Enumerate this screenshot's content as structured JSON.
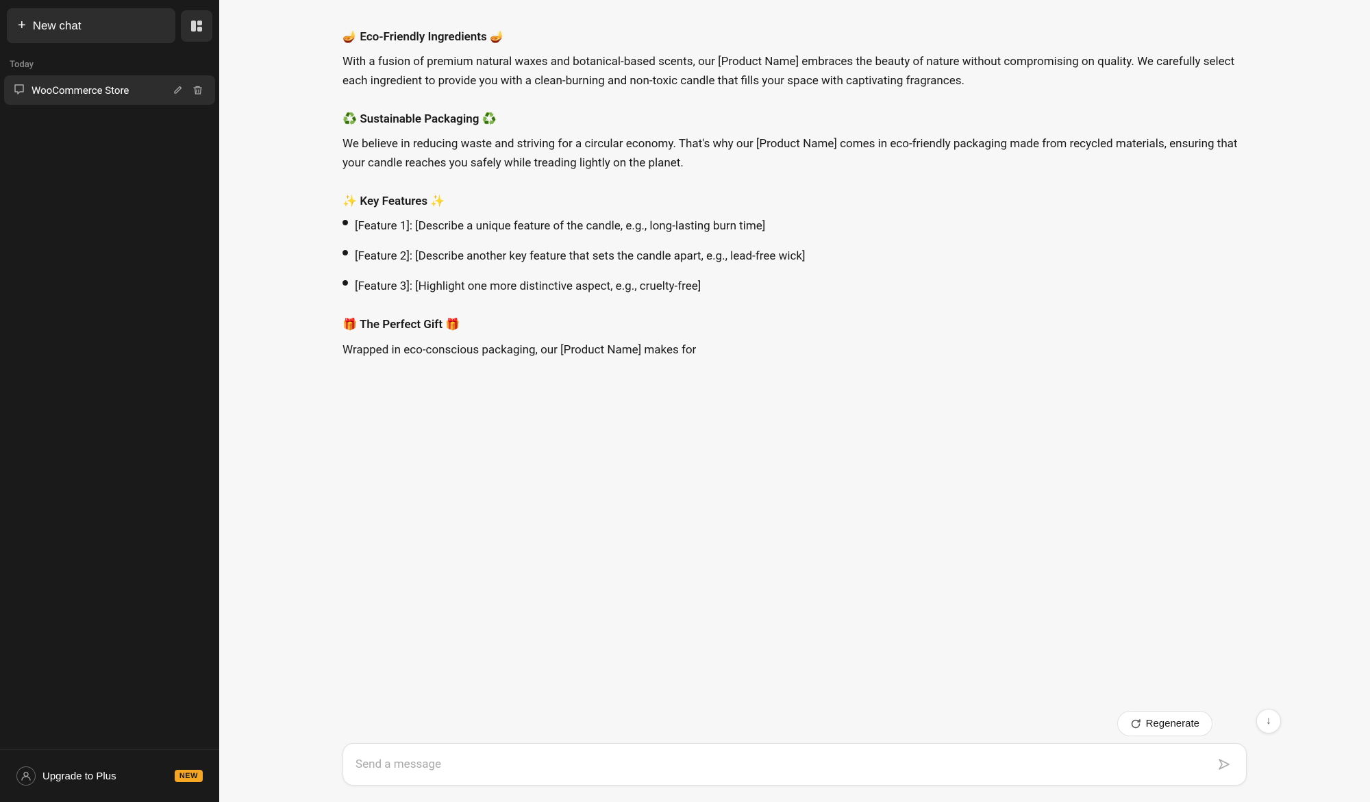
{
  "sidebar": {
    "new_chat_label": "New chat",
    "toggle_icon": "⊞",
    "section_today": "Today",
    "chat_items": [
      {
        "id": "woocommerce-store",
        "title": "WooCommerce Store"
      }
    ],
    "upgrade_label": "Upgrade to Plus",
    "upgrade_badge": "NEW"
  },
  "main": {
    "sections": [
      {
        "id": "eco-friendly",
        "heading": "🪔 Eco-Friendly Ingredients 🪔",
        "body": "With a fusion of premium natural waxes and botanical-based scents, our [Product Name] embraces the beauty of nature without compromising on quality. We carefully select each ingredient to provide you with a clean-burning and non-toxic candle that fills your space with captivating fragrances."
      },
      {
        "id": "sustainable-packaging",
        "heading": "♻️ Sustainable Packaging ♻️",
        "body": "We believe in reducing waste and striving for a circular economy. That's why our [Product Name] comes in eco-friendly packaging made from recycled materials, ensuring that your candle reaches you safely while treading lightly on the planet."
      },
      {
        "id": "key-features",
        "heading": "✨ Key Features ✨",
        "body": null,
        "bullets": [
          "[Feature 1]: [Describe a unique feature of the candle, e.g., long-lasting burn time]",
          "[Feature 2]: [Describe another key feature that sets the candle apart, e.g., lead-free wick]",
          "[Feature 3]: [Highlight one more distinctive aspect, e.g., cruelty-free]"
        ]
      },
      {
        "id": "perfect-gift",
        "heading": "🎁 The Perfect Gift 🎁",
        "body": "Wrapped in eco-conscious packaging, our [Product Name] makes for"
      }
    ],
    "regenerate_label": "Regenerate",
    "input_placeholder": "Send a message",
    "scroll_down_icon": "↓"
  }
}
